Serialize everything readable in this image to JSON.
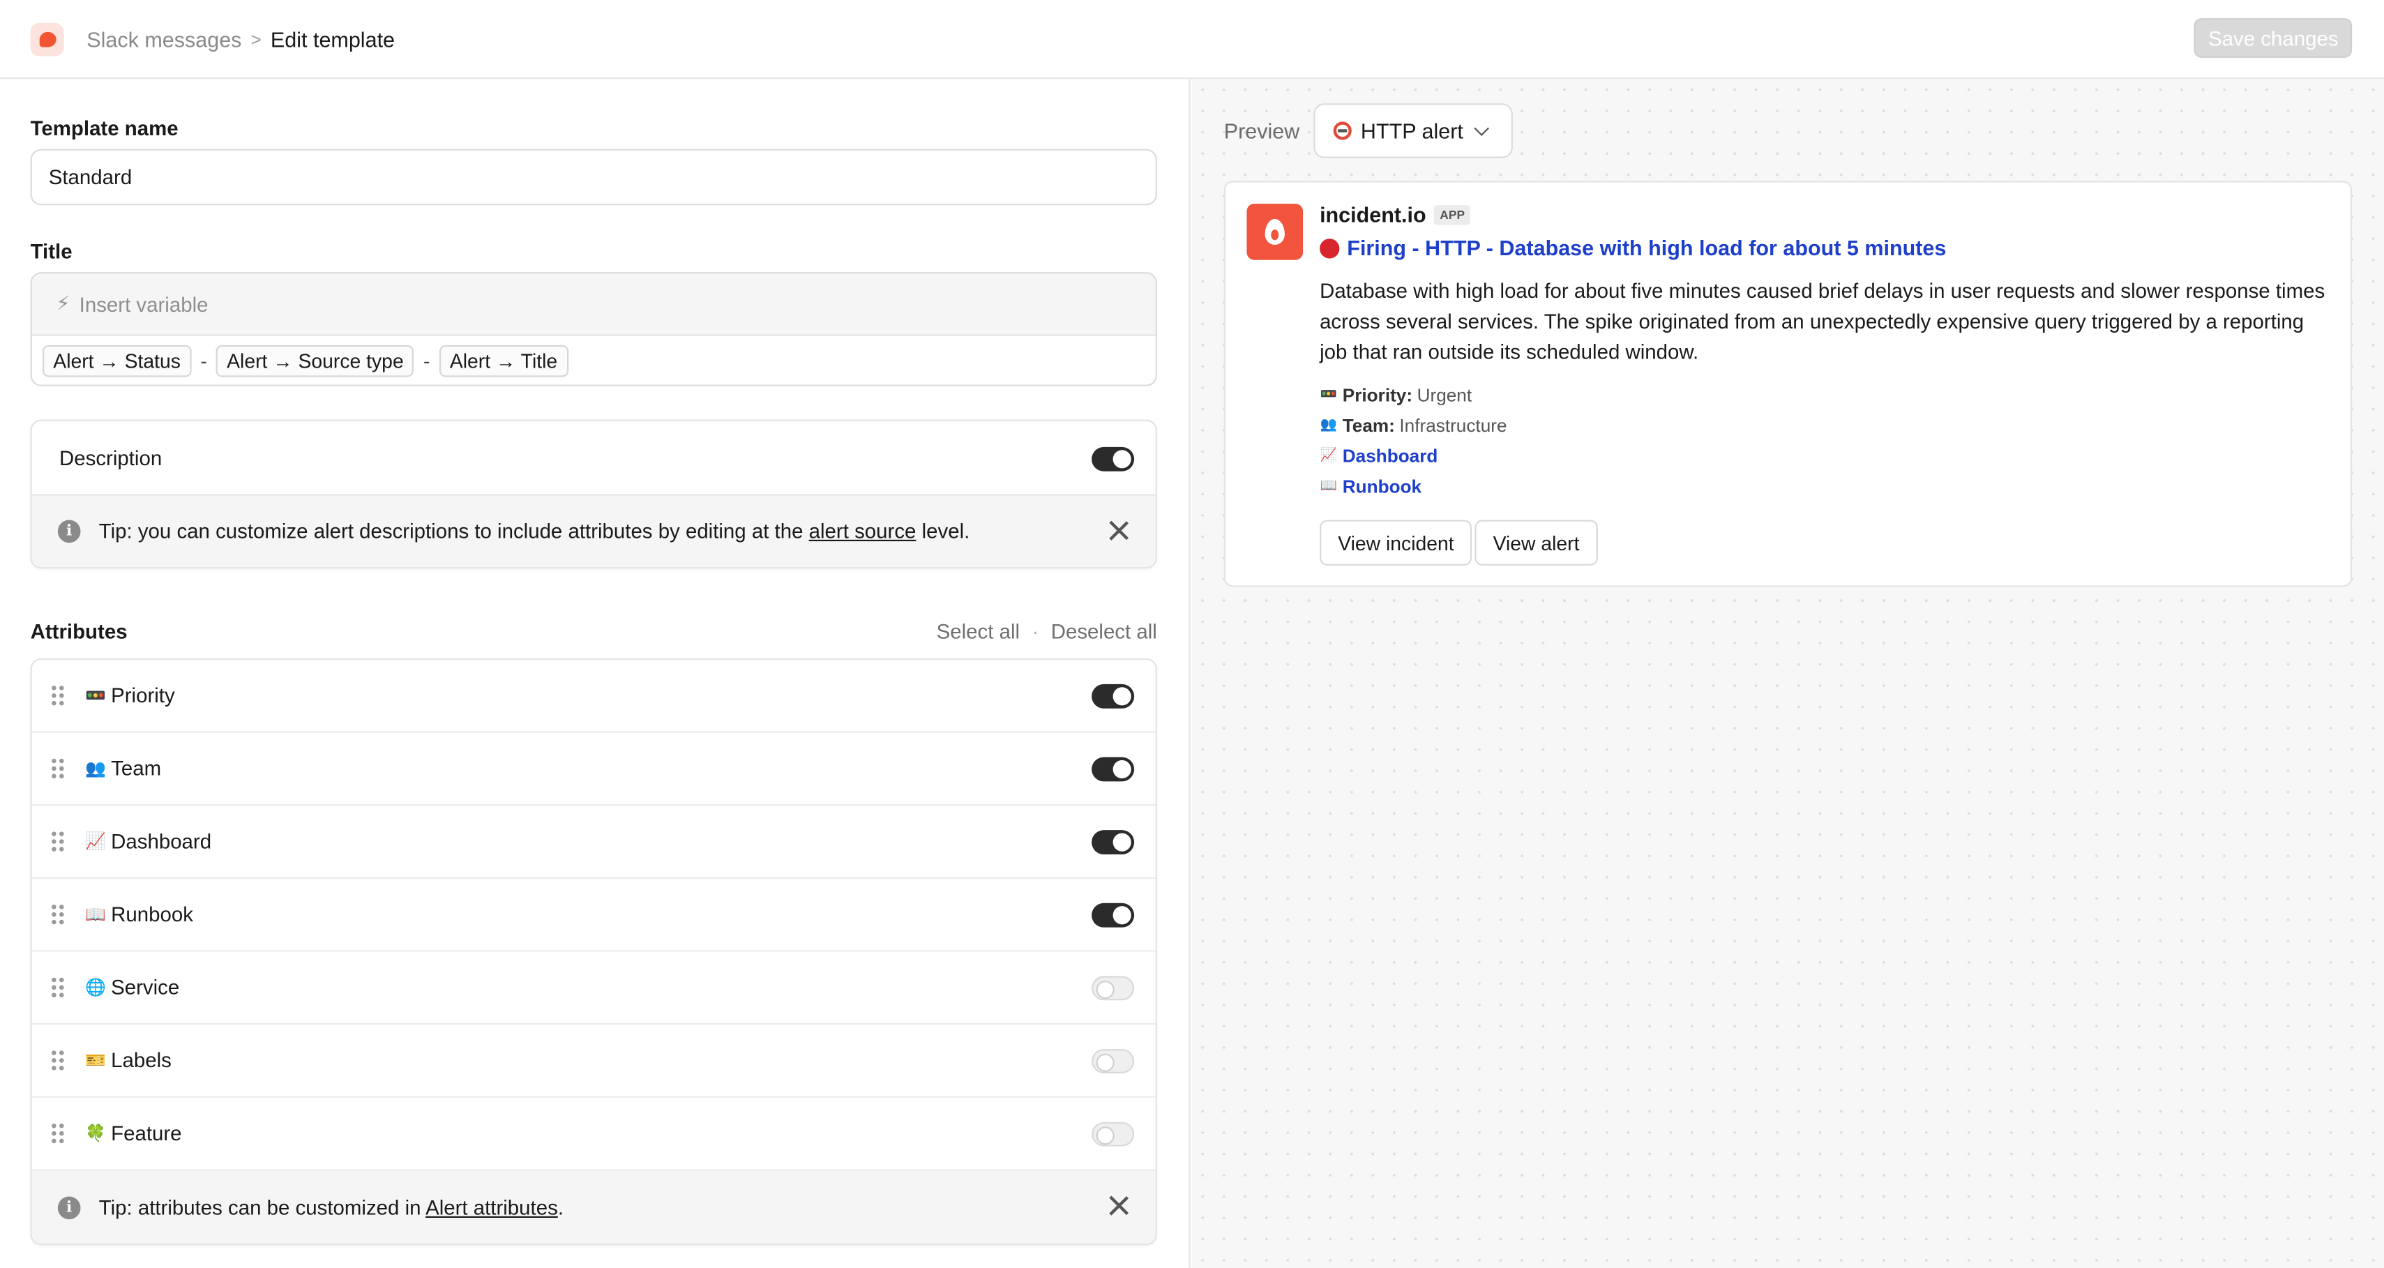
{
  "header": {
    "breadcrumb_parent": "Slack messages",
    "breadcrumb_separator": ">",
    "breadcrumb_current": "Edit template",
    "save_label": "Save changes"
  },
  "template_name": {
    "label": "Template name",
    "value": "Standard"
  },
  "title_field": {
    "label": "Title",
    "insert_variable": "Insert variable",
    "chips": [
      "Alert → Status",
      "Alert → Source type",
      "Alert → Title"
    ],
    "separator": "-"
  },
  "description": {
    "label": "Description",
    "enabled": true,
    "tip_prefix": "Tip: you can customize alert descriptions to include attributes by editing at the ",
    "tip_link": "alert source",
    "tip_suffix": " level."
  },
  "attributes": {
    "label": "Attributes",
    "select_all": "Select all",
    "separator": "·",
    "deselect_all": "Deselect all",
    "items": [
      {
        "icon": "traffic-light-icon",
        "glyph": "🚥",
        "label": "Priority",
        "enabled": true
      },
      {
        "icon": "people-icon",
        "glyph": "👥",
        "label": "Team",
        "enabled": true
      },
      {
        "icon": "chart-icon",
        "glyph": "📈",
        "label": "Dashboard",
        "enabled": true
      },
      {
        "icon": "book-icon",
        "glyph": "📖",
        "label": "Runbook",
        "enabled": true
      },
      {
        "icon": "globe-icon",
        "glyph": "🌐",
        "label": "Service",
        "enabled": false
      },
      {
        "icon": "ticket-icon",
        "glyph": "🎫",
        "label": "Labels",
        "enabled": false
      },
      {
        "icon": "clover-icon",
        "glyph": "🍀",
        "label": "Feature",
        "enabled": false
      }
    ],
    "tip_prefix": "Tip: attributes can be customized in ",
    "tip_link": "Alert attributes",
    "tip_suffix": "."
  },
  "preview": {
    "label": "Preview",
    "selected": "HTTP alert",
    "message": {
      "bot_name": "incident.io",
      "badge": "APP",
      "title": "Firing - HTTP - Database with high load for about 5 minutes",
      "body": "Database with high load for about five minutes caused brief delays in user requests and slower response times across several services. The spike originated from an unexpectedly expensive query triggered by a reporting job that ran outside its scheduled window.",
      "priority_label": "Priority:",
      "priority_value": "Urgent",
      "team_label": "Team:",
      "team_value": "Infrastructure",
      "dashboard_link": "Dashboard",
      "runbook_link": "Runbook",
      "view_incident": "View incident",
      "view_alert": "View alert"
    }
  },
  "colors": {
    "accent_red": "#f2543d",
    "link_blue": "#1d3fc9",
    "toggle_on": "#2b2b2b"
  }
}
